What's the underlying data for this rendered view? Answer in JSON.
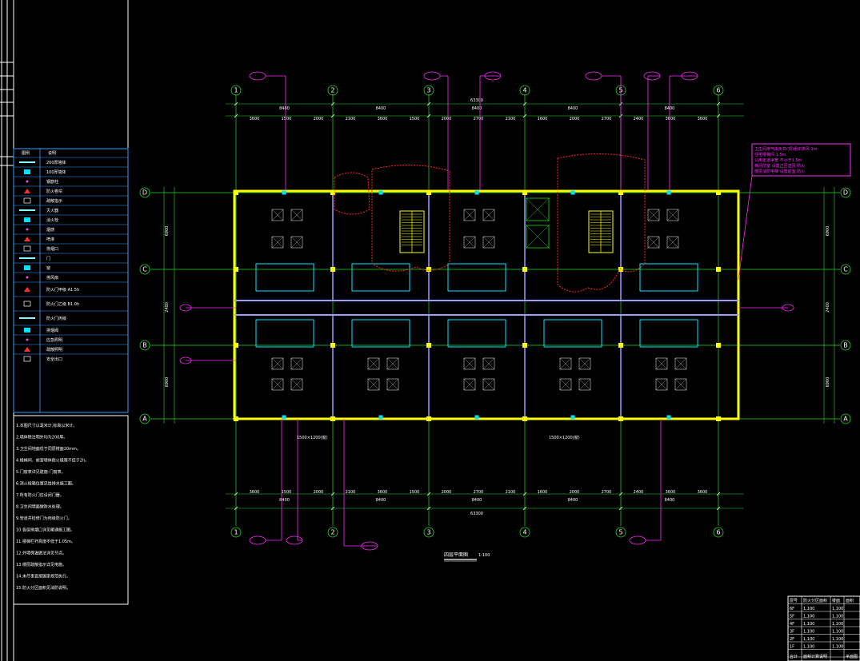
{
  "drawing": {
    "plan_title": "四层平面图",
    "plan_scale": "1:100",
    "total_dim": "63300",
    "top_dims": [
      "8400",
      "8400",
      "8400",
      "8400",
      "8400"
    ],
    "column_labels": [
      "1",
      "2",
      "3",
      "4",
      "5",
      "6"
    ],
    "row_labels": [
      "D",
      "C",
      "B",
      "A"
    ],
    "sub_dims_top": [
      "3600",
      "1500",
      "2000",
      "2100",
      "3600",
      "1500",
      "2000",
      "2700",
      "2100",
      "1600",
      "2000",
      "2700",
      "2400",
      "3600",
      "3600"
    ],
    "side_dims_left": [
      "6900",
      "2400",
      "6900"
    ],
    "note_box_lines": [
      "卫生间排气由天井(顶)组织排风 1m",
      "住宅楼梯间 1.5m",
      "公用走道净宽 不小于1.5m",
      "梯间前室 设置正压送风 防火",
      "楼层消防电梯 设置前室 防火"
    ],
    "window_labels": [
      "1500×1200(窗)",
      "1500×1200(窗)"
    ]
  },
  "legend": {
    "header_symbol": "图例",
    "header_desc": "说明",
    "items": [
      "200厚墙体",
      "100厚墙体",
      "钢筋柱",
      "防火卷帘",
      "疏散指示",
      "灭火器",
      "消火栓",
      "烟感",
      "喷淋",
      "排烟口",
      "门",
      "窗",
      "排风扇",
      "防火门甲级 A1.5h",
      "防火门乙级 B1.0h",
      "防火门丙级",
      "排烟阀",
      "应急照明",
      "疏散照明",
      "安全出口"
    ]
  },
  "notes": {
    "lines": [
      "1.本图尺寸以毫米计,标高以米计。",
      "2.墙体除注明外均为200厚。",
      "3.卫生间地面低于同层楼面20mm。",
      "4.楼梯间、前室墙体耐火极限不低于2h。",
      "5.门窗表详见建施-门窗表。",
      "6.消火栓箱位置见给排水施工图。",
      "7.所有防火门应设闭门器。",
      "8.卫生间墙面做防水处理。",
      "9.管道井检修门为丙级防火门。",
      "10.各层排烟口详见暖通施工图。",
      "11.楼梯栏杆高度不低于1.05m。",
      "12.外墙保温做法详见节点。",
      "13.楼层疏散指示详见电施。",
      "14.未尽事宜按国家规范执行。",
      "15.防火分区面积见消防说明。"
    ]
  },
  "title_block": {
    "header": [
      "层号",
      "防火分区面积",
      "楼面",
      "面积"
    ],
    "rows": [
      [
        "6F",
        "1,100",
        "1,100"
      ],
      [
        "5F",
        "1,100",
        "1,100"
      ],
      [
        "4F",
        "1,100",
        "1,100"
      ],
      [
        "3F",
        "1,100",
        "1,100"
      ],
      [
        "2F",
        "1,100",
        "1,100"
      ],
      [
        "1F",
        "1,100",
        "1,100"
      ]
    ],
    "footer": [
      "合计",
      "面积计算说明",
      "平面图"
    ]
  }
}
